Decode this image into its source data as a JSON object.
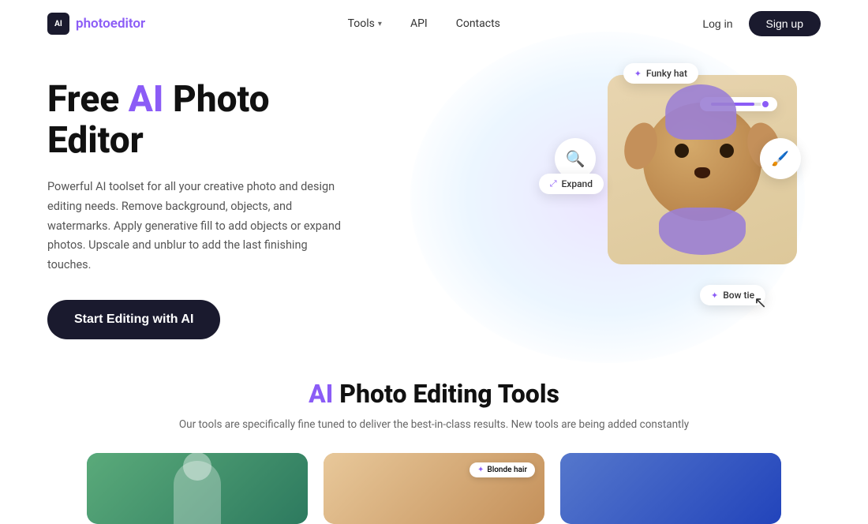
{
  "nav": {
    "logo_icon": "AI",
    "logo_text_main": "photo",
    "logo_text_accent": "editor",
    "links": [
      {
        "label": "Tools",
        "has_dropdown": true
      },
      {
        "label": "API",
        "has_dropdown": false
      },
      {
        "label": "Contacts",
        "has_dropdown": false
      }
    ],
    "login_label": "Log in",
    "signup_label": "Sign up"
  },
  "hero": {
    "title_prefix": "Free ",
    "title_ai": "AI",
    "title_suffix": " Photo\nEditor",
    "description": "Powerful AI toolset for all your creative photo and design editing needs. Remove background, objects, and watermarks. Apply generative fill to add objects or expand photos. Upscale and unblur to add the last finishing touches.",
    "cta_label": "Start Editing with AI",
    "chips": {
      "funky_hat": "Funky hat",
      "expand": "Expand",
      "bow_tie": "Bow tie"
    }
  },
  "tools_section": {
    "title_ai": "AI",
    "title_suffix": " Photo Editing Tools",
    "description": "Our tools are specifically fine tuned to deliver the best-in-class results. New tools\nare being added constantly",
    "card2_chip": "Blonde hair"
  },
  "colors": {
    "accent": "#8b5cf6",
    "dark": "#1a1a2e"
  }
}
